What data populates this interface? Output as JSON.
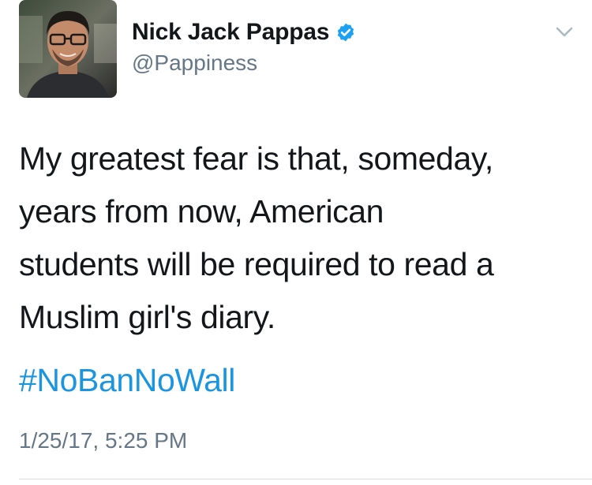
{
  "author": {
    "display_name": "Nick Jack Pappas",
    "handle": "@Pappiness",
    "verified": true,
    "avatar_icon": "profile-photo"
  },
  "tweet": {
    "text_lines": [
      "My greatest fear is that, someday,",
      "years from now, American",
      "students will be required to read a",
      "Muslim girl's diary."
    ],
    "hashtag": "#NoBanNoWall",
    "timestamp": "1/25/17, 5:25 PM"
  },
  "colors": {
    "hashtag": "#1b95e0",
    "verified_badge": "#1da1f2",
    "secondary_text": "#657786"
  },
  "icons": {
    "menu": "chevron-down-icon",
    "verified": "verified-badge-icon"
  }
}
